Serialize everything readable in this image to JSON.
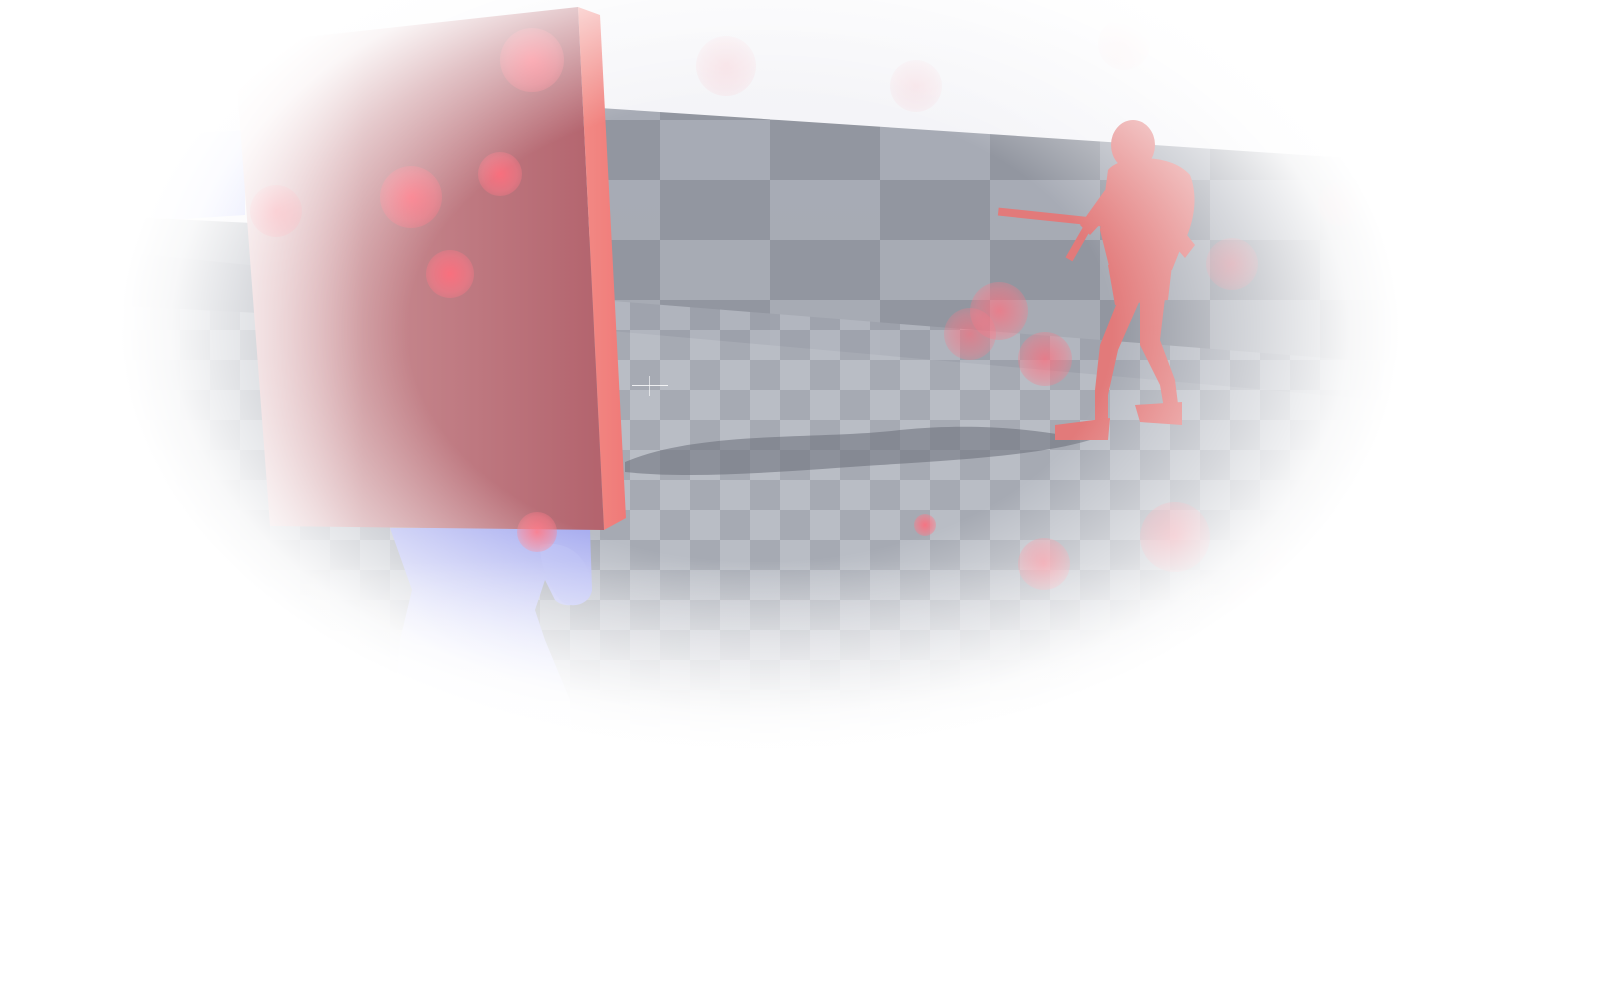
{
  "scene": {
    "colors": {
      "sky": "#eeeef3",
      "floor_light": "#a9adb7",
      "floor_dark": "#8a8e98",
      "cover_block": "#d8737a",
      "cover_edge": "#f07e7e",
      "enemy": "#e27a7a",
      "player": "#b8bdf5",
      "orb": "#ff6e7d"
    },
    "icons": {
      "crosshair": "crosshair-icon"
    }
  }
}
